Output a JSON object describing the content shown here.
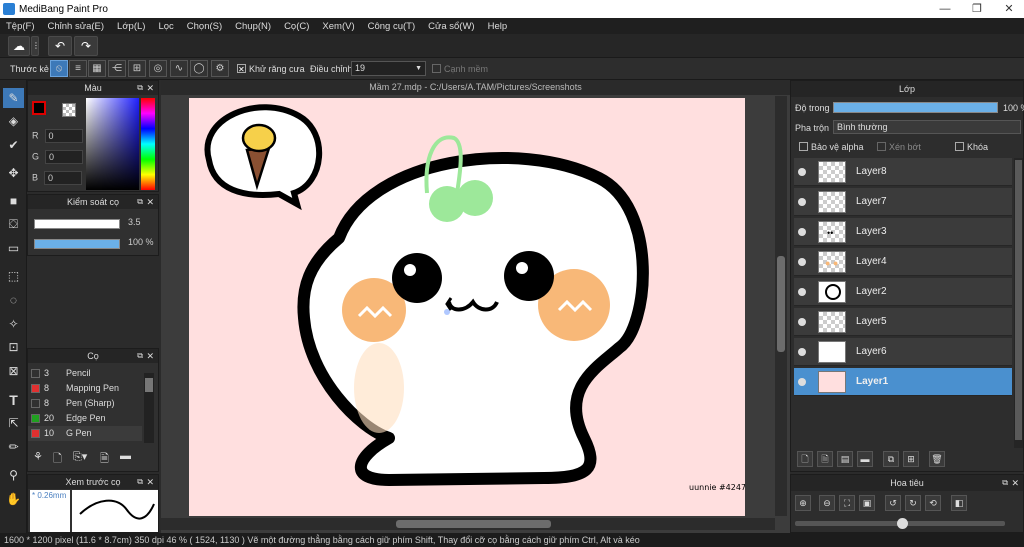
{
  "app": {
    "title": "MediBang Paint Pro"
  },
  "window_controls": {
    "minimize": "—",
    "maximize": "❐",
    "close": "✕"
  },
  "menu": [
    "Tệp(F)",
    "Chỉnh sửa(E)",
    "Lớp(L)",
    "Lọc",
    "Chọn(S)",
    "Chụp(N)",
    "Cọ(C)",
    "Xem(V)",
    "Công cụ(T)",
    "Cửa sổ(W)",
    "Help"
  ],
  "toolbar2": {
    "stroke_label": "Thước kẻ",
    "antialias_label": "Khử răng cưa",
    "correction_label": "Điều chỉnh",
    "correction_value": "19",
    "soft_edge_label": "Cạnh mềm"
  },
  "color_panel": {
    "title": "Màu",
    "r_label": "R",
    "g_label": "G",
    "b_label": "B",
    "r": "0",
    "g": "0",
    "b": "0"
  },
  "brush_control": {
    "title": "Kiểm soát cọ",
    "size": "3.5",
    "opacity": "100 %"
  },
  "brush_panel": {
    "title": "Cọ",
    "items": [
      {
        "size": "3",
        "name": "Pencil",
        "color": "#303030"
      },
      {
        "size": "8",
        "name": "Mapping Pen",
        "color": "#e03030"
      },
      {
        "size": "8",
        "name": "Pen (Sharp)",
        "color": "#303030"
      },
      {
        "size": "20",
        "name": "Edge Pen",
        "color": "#20a020"
      },
      {
        "size": "10",
        "name": "G Pen",
        "color": "#e03030"
      }
    ]
  },
  "preview_panel": {
    "title": "Xem trước cọ",
    "size": "* 0.26mm"
  },
  "document": {
    "tab": "Mầm 27.mdp - C:/Users/A.TAM/Pictures/Screenshots",
    "signature": "uunnie #4247"
  },
  "layer_panel": {
    "title": "Lớp",
    "opacity_label": "Độ trong",
    "opacity_value": "100 %",
    "blend_label": "Pha trộn",
    "blend_value": "Bình thường",
    "protect_alpha": "Bảo vệ alpha",
    "clipping": "Xén bớt",
    "lock": "Khóa",
    "layers": [
      {
        "name": "Layer8",
        "selected": false
      },
      {
        "name": "Layer7",
        "selected": false
      },
      {
        "name": "Layer3",
        "selected": false
      },
      {
        "name": "Layer4",
        "selected": false
      },
      {
        "name": "Layer2",
        "selected": false
      },
      {
        "name": "Layer5",
        "selected": false
      },
      {
        "name": "Layer6",
        "selected": false
      },
      {
        "name": "Layer1",
        "selected": true
      }
    ]
  },
  "navigator": {
    "title": "Hoa tiêu"
  },
  "status": {
    "text": "1600 * 1200 pixel   (11.6 * 8.7cm)   350 dpi   46 %   ( 1524, 1130 )   Vẽ một đường thẳng bằng cách giữ phím Shift, Thay đổi cỡ cọ bằng cách giữ phím Ctrl, Alt và kéo"
  },
  "colors": {
    "accent": "#4a90cf",
    "canvas_bg": "#ffdfdf",
    "cheek": "#f8b878",
    "sprout": "#9de89a"
  }
}
